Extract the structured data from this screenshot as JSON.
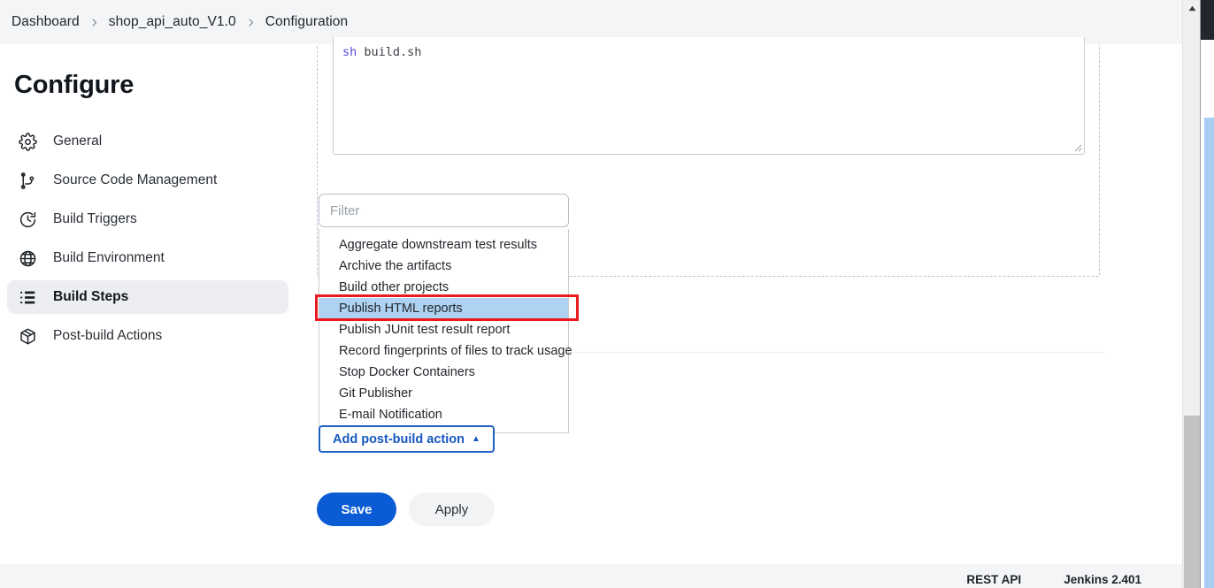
{
  "breadcrumb": {
    "items": [
      {
        "label": "Dashboard"
      },
      {
        "label": "shop_api_auto_V1.0"
      },
      {
        "label": "Configuration"
      }
    ],
    "separator_icon": "chevron-right-icon"
  },
  "sidebar": {
    "title": "Configure",
    "items": [
      {
        "label": "General",
        "icon": "gear-icon",
        "active": false
      },
      {
        "label": "Source Code Management",
        "icon": "git-branch-icon",
        "active": false
      },
      {
        "label": "Build Triggers",
        "icon": "clock-icon",
        "active": false
      },
      {
        "label": "Build Environment",
        "icon": "globe-icon",
        "active": false
      },
      {
        "label": "Build Steps",
        "icon": "list-icon",
        "active": true
      },
      {
        "label": "Post-build Actions",
        "icon": "package-icon",
        "active": false
      }
    ]
  },
  "main": {
    "code_editor": {
      "keyword": "sh",
      "text": " build.sh",
      "resize_handle_icon": "resize-grip-icon"
    },
    "filter": {
      "value": "",
      "placeholder": "Filter"
    },
    "options": [
      {
        "label": "Aggregate downstream test results",
        "selected": false
      },
      {
        "label": "Archive the artifacts",
        "selected": false
      },
      {
        "label": "Build other projects",
        "selected": false
      },
      {
        "label": "Publish HTML reports",
        "selected": true
      },
      {
        "label": "Publish JUnit test result report",
        "selected": false
      },
      {
        "label": "Record fingerprints of files to track usage",
        "selected": false
      },
      {
        "label": "Stop Docker Containers",
        "selected": false
      },
      {
        "label": "Git Publisher",
        "selected": false
      },
      {
        "label": "E-mail Notification",
        "selected": false
      }
    ],
    "add_post_build_action": {
      "label": "Add post-build action",
      "caret_icon": "caret-up-icon"
    },
    "save_label": "Save",
    "apply_label": "Apply"
  },
  "footer": {
    "rest_api_label": "REST API",
    "version_label": "Jenkins 2.401"
  },
  "scrollbar": {
    "arrow_up_icon": "scroll-up-arrow-icon"
  },
  "colors": {
    "accent_blue": "#0a5bd4",
    "selection_blue": "#aed2f2",
    "highlight_red": "#ea1b20",
    "sidebar_active_bg": "#eceef2",
    "bar_bg": "#f4f5f7",
    "code_keyword": "#5b4ae0"
  }
}
